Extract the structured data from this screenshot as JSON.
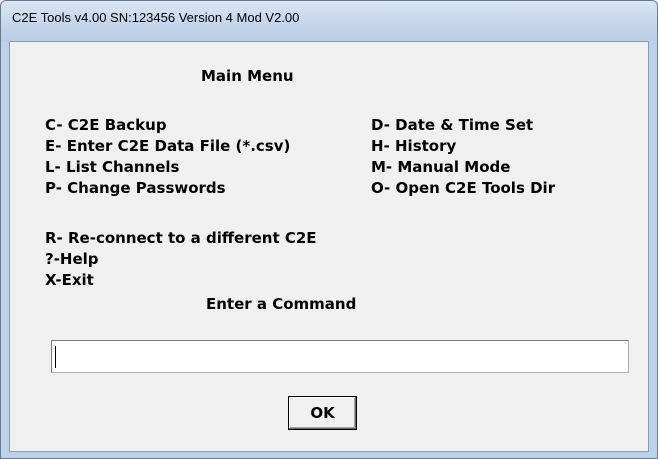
{
  "window": {
    "title": "C2E Tools v4.00 SN:123456 Version 4 Mod V2.00"
  },
  "menu": {
    "heading": "Main Menu",
    "left_items": [
      "C- C2E Backup",
      "E- Enter C2E Data File (*.csv)",
      "L- List Channels",
      "P- Change Passwords"
    ],
    "right_items": [
      "D- Date & Time Set",
      "H- History",
      "M- Manual Mode",
      "O- Open C2E Tools Dir"
    ],
    "extra_items": [
      "R- Re-connect to a different C2E",
      "?-Help",
      "X-Exit"
    ],
    "prompt": "Enter a Command"
  },
  "command": {
    "value": ""
  },
  "buttons": {
    "ok_label": "OK"
  },
  "colors": {
    "frame": "#bcd1ea",
    "client_background": "#f0f0f0"
  }
}
